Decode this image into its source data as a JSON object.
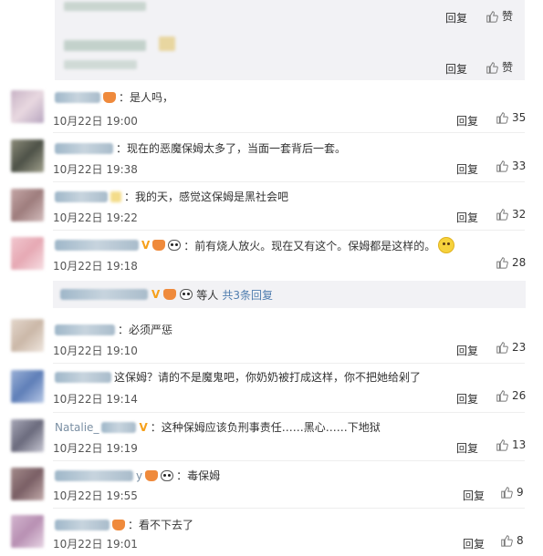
{
  "nested_replies": [
    {
      "reply": "回复",
      "like": "赞"
    },
    {
      "reply": "回复",
      "like": "赞"
    }
  ],
  "comments": [
    {
      "text": "：是人吗，",
      "time": "10月22日 19:00",
      "reply": "回复",
      "likes": "35"
    },
    {
      "text": "：现在的恶魔保姆太多了，当面一套背后一套。",
      "time": "10月22日 19:38",
      "reply": "回复",
      "likes": "33"
    },
    {
      "text": "：我的天，感觉这保姆是黑社会吧",
      "time": "10月22日 19:22",
      "reply": "回复",
      "likes": "32"
    },
    {
      "text": "：前有烧人放火。现在又有这个。保姆都是这样的。",
      "time": "10月22日 19:18",
      "reply": "回复",
      "likes": "28"
    },
    {
      "text": "：必须严惩",
      "time": "10月22日 19:10",
      "reply": "回复",
      "likes": "23"
    },
    {
      "text": "这保姆？请的不是魔鬼吧，你奶奶被打成这样，你不把她给剁了",
      "time": "10月22日 19:14",
      "reply": "回复",
      "likes": "26"
    },
    {
      "username_visible": "Natalie_",
      "text": "：这种保姆应该负刑事责任……黑心……下地狱",
      "time": "10月22日 19:19",
      "reply": "回复",
      "likes": "13"
    },
    {
      "username_visible": "y",
      "text": "：毒保姆",
      "time": "10月22日 19:55",
      "reply": "回复",
      "likes": "9"
    },
    {
      "text": "：看不下去了",
      "time": "10月22日 19:01",
      "reply": "回复",
      "likes": "8"
    }
  ],
  "more_replies": {
    "suffix": "等人",
    "link": "共3条回复"
  },
  "icons": {
    "like": "thumbs-up-icon",
    "vip": "vip-v-icon",
    "member": "crown-icon",
    "panda": "panda-icon",
    "smile": "smile-emoji-icon"
  },
  "colors": {
    "link": "#507daf",
    "nested_bg": "#f2f2f5",
    "vip": "#f6a01a"
  }
}
